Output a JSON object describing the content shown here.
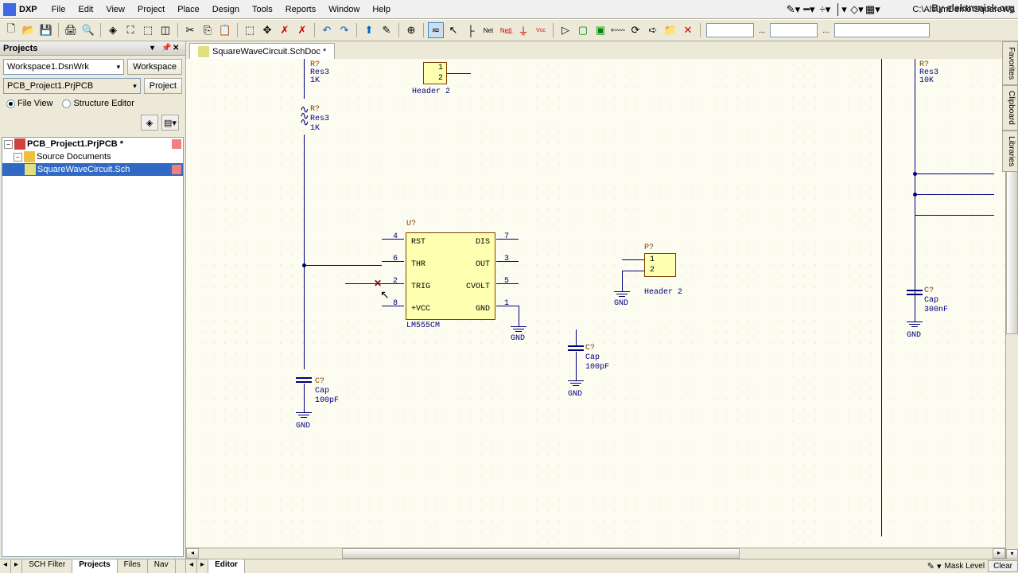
{
  "app": {
    "name": "DXP",
    "path": "C:\\AltiumDemo\\SquareWa",
    "watermark": "By elektronisk.org"
  },
  "menu": [
    "File",
    "Edit",
    "View",
    "Project",
    "Place",
    "Design",
    "Tools",
    "Reports",
    "Window",
    "Help"
  ],
  "projects_panel": {
    "title": "Projects",
    "workspace": "Workspace1.DsnWrk",
    "workspace_btn": "Workspace",
    "project": "PCB_Project1.PrjPCB",
    "project_btn": "Project",
    "file_view": "File View",
    "structure_editor": "Structure Editor"
  },
  "tree": {
    "root": "PCB_Project1.PrjPCB *",
    "folder": "Source Documents",
    "file": "SquareWaveCircuit.Sch"
  },
  "bottom_tabs": {
    "sch_filter": "SCH Filter",
    "projects": "Projects",
    "files": "Files",
    "nav": "Nav"
  },
  "doc_tab": "SquareWaveCircuit.SchDoc *",
  "editor_tab": "Editor",
  "status": {
    "mask": "Mask Level",
    "clear": "Clear"
  },
  "right_tabs": [
    "Favorites",
    "Clipboard",
    "Libraries"
  ],
  "sch": {
    "r1": {
      "des": "R?",
      "val": "Res3",
      "rating": "1K"
    },
    "r2": {
      "des": "R?",
      "val": "Res3",
      "rating": "1K"
    },
    "r3": {
      "des": "R?",
      "val": "Res3",
      "rating": "10K"
    },
    "u1": {
      "des": "U?",
      "part": "LM555CM",
      "pins_left": [
        "RST",
        "THR",
        "TRIG",
        "+VCC"
      ],
      "pins_right": [
        "DIS",
        "OUT",
        "CVOLT",
        "GND"
      ],
      "nums_left": [
        "4",
        "6",
        "2",
        "8"
      ],
      "nums_right": [
        "7",
        "3",
        "5",
        "1"
      ]
    },
    "p1": {
      "des": "P?",
      "val": "Header 2",
      "pins": [
        "1",
        "2"
      ]
    },
    "p2": {
      "des": "P?",
      "val": "Header 2",
      "pins": [
        "1",
        "2"
      ]
    },
    "c1": {
      "des": "C?",
      "val": "Cap",
      "rating": "100pF"
    },
    "c2": {
      "des": "C?",
      "val": "Cap",
      "rating": "100pF"
    },
    "c3": {
      "des": "C?",
      "val": "Cap",
      "rating": "300nF"
    },
    "gnd": "GND"
  }
}
